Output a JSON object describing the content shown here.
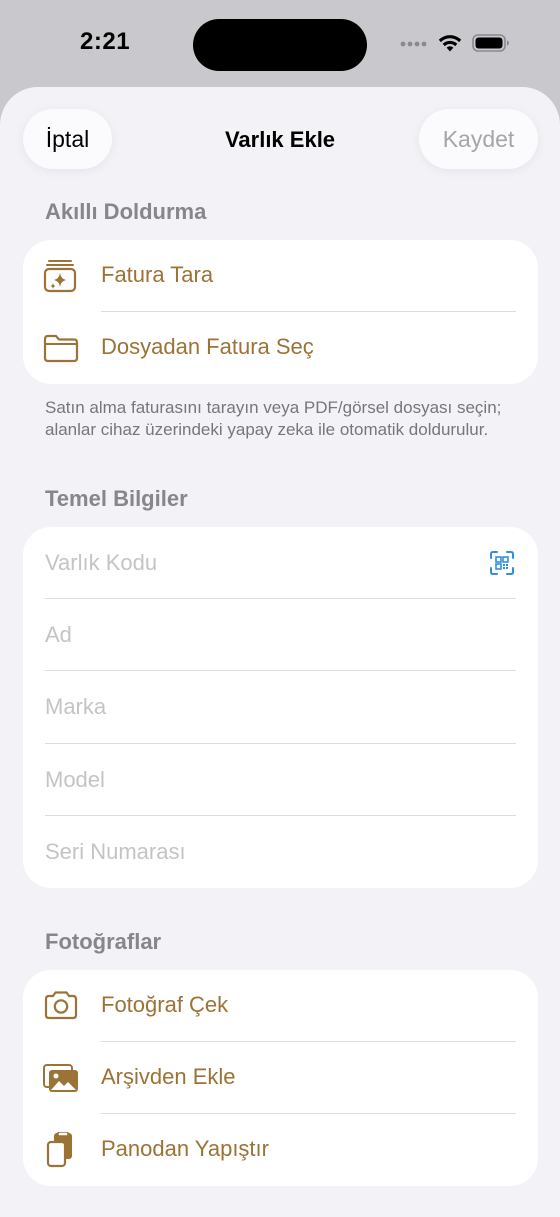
{
  "status_bar": {
    "time": "2:21"
  },
  "nav": {
    "cancel_label": "İptal",
    "title": "Varlık Ekle",
    "save_label": "Kaydet"
  },
  "smart_fill": {
    "header": "Akıllı Doldurma",
    "items": [
      {
        "label": "Fatura Tara",
        "icon": "scan-invoice-icon"
      },
      {
        "label": "Dosyadan Fatura Seç",
        "icon": "folder-icon"
      }
    ],
    "footer": "Satın alma faturasını tarayın veya PDF/görsel dosyası seçin; alanlar cihaz üzerindeki yapay zeka ile otomatik doldurulur."
  },
  "basic_info": {
    "header": "Temel Bilgiler",
    "fields": [
      {
        "placeholder": "Varlık Kodu"
      },
      {
        "placeholder": "Ad"
      },
      {
        "placeholder": "Marka"
      },
      {
        "placeholder": "Model"
      },
      {
        "placeholder": "Seri Numarası"
      }
    ]
  },
  "photos": {
    "header": "Fotoğraflar",
    "items": [
      {
        "label": "Fotoğraf Çek",
        "icon": "camera-icon"
      },
      {
        "label": "Arşivden Ekle",
        "icon": "photo-library-icon"
      },
      {
        "label": "Panodan Yapıştır",
        "icon": "clipboard-paste-icon"
      }
    ]
  },
  "colors": {
    "accent": "#9c7336",
    "qr_blue": "#2f8fe0",
    "placeholder": "#c4c4c7",
    "sheet_bg": "#f2f2f7"
  }
}
